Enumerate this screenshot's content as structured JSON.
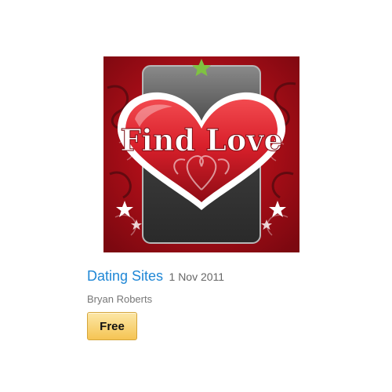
{
  "app": {
    "icon": {
      "name": "find-love-heart-icon",
      "text": "Find Love"
    },
    "title": "Dating Sites",
    "release_date": "1 Nov 2011",
    "author": "Bryan Roberts",
    "price_label": "Free"
  },
  "colors": {
    "title_link": "#1f87d6",
    "price_button": "#f5c453",
    "icon_background": "#b00f1c",
    "heart_red": "#d9202b"
  }
}
